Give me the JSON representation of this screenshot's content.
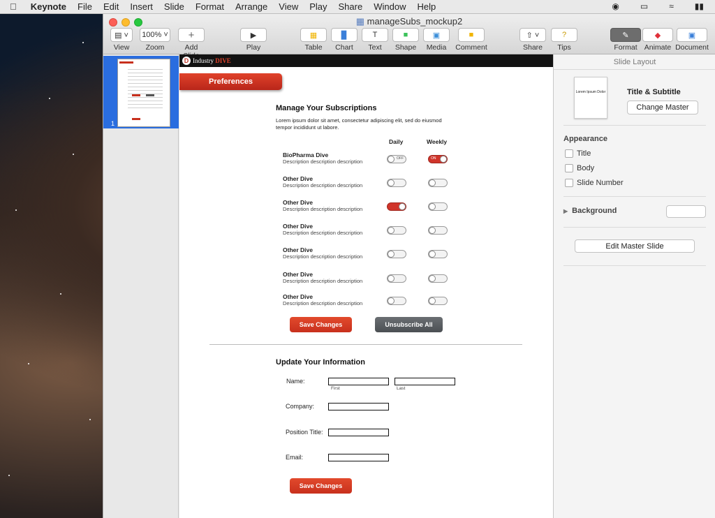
{
  "menubar": {
    "app": "Keynote",
    "items": [
      "File",
      "Edit",
      "Insert",
      "Slide",
      "Format",
      "Arrange",
      "View",
      "Play",
      "Share",
      "Window",
      "Help"
    ]
  },
  "window": {
    "title": "manageSubs_mockup2",
    "toolbar": {
      "view": "View",
      "zoom_value": "100%",
      "zoom": "Zoom",
      "add_slide": "Add Slide",
      "play": "Play",
      "table": "Table",
      "chart": "Chart",
      "text": "Text",
      "shape": "Shape",
      "media": "Media",
      "comment": "Comment",
      "share": "Share",
      "tips": "Tips",
      "format": "Format",
      "animate": "Animate",
      "document": "Document"
    }
  },
  "sidebar": {
    "slide_number": "1"
  },
  "slide": {
    "brand": "Industry DIVE",
    "brand_a": "Industry",
    "brand_b": "DIVE",
    "pref_button": "Preferences",
    "manage_title": "Manage Your Subscriptions",
    "intro_line1": "Lorem ipsum dolor sit amet, consectetur adipiscing elit, sed do eiusmod",
    "intro_line2": "tempor incididunt ut labore.",
    "col_daily": "Daily",
    "col_weekly": "Weekly",
    "dives": [
      {
        "name": "BioPharma Dive",
        "desc": "Description description description",
        "daily": "off",
        "weekly": "on"
      },
      {
        "name": "Other Dive",
        "desc": "Description description description",
        "daily": "off",
        "weekly": "off"
      },
      {
        "name": "Other Dive",
        "desc": "Description description description",
        "daily": "on",
        "weekly": "off"
      },
      {
        "name": "Other Dive",
        "desc": "Description description description",
        "daily": "off",
        "weekly": "off"
      },
      {
        "name": "Other Dive",
        "desc": "Description description description",
        "daily": "off",
        "weekly": "off"
      },
      {
        "name": "Other Dive",
        "desc": "Description description description",
        "daily": "off",
        "weekly": "off"
      },
      {
        "name": "Other Dive",
        "desc": "Description description description",
        "daily": "off",
        "weekly": "off"
      }
    ],
    "toggle_off_text": "OFF",
    "toggle_on_text": "ON",
    "save_changes": "Save Changes",
    "unsubscribe_all": "Unsubscribe All",
    "update_title": "Update Your Information",
    "name_label": "Name:",
    "first": "First",
    "last": "Last",
    "company_label": "Company:",
    "position_label": "Position Title:",
    "email_label": "Email:",
    "save_changes_2": "Save Changes"
  },
  "inspector": {
    "header": "Slide Layout",
    "master_thumb_text": "Lorem Ipsum Dolor",
    "layout_name": "Title & Subtitle",
    "change_master": "Change Master",
    "appearance": "Appearance",
    "opt_title": "Title",
    "opt_body": "Body",
    "opt_slide_number": "Slide Number",
    "background": "Background",
    "edit_master": "Edit Master Slide"
  },
  "colors": {
    "accent_red": "#d0342a",
    "selection_blue": "#2a6ddf"
  }
}
